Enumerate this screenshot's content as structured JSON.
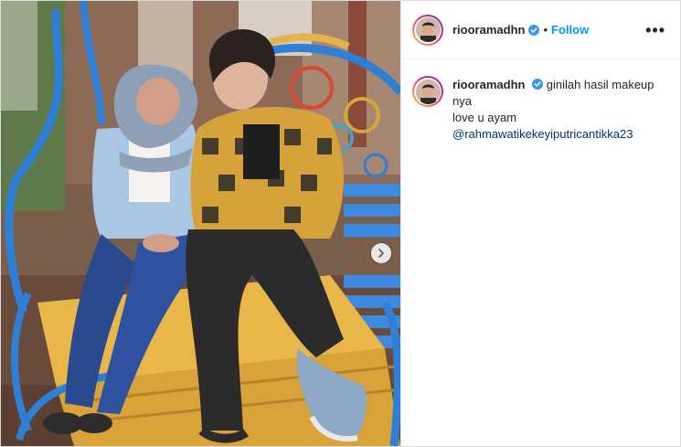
{
  "post": {
    "username": "riooramadhn",
    "follow_label": "Follow",
    "separator": "•",
    "more_label": "•••"
  },
  "caption": {
    "username": "riooramadhn",
    "line1": "ginilah hasil makeup",
    "line2": "nya",
    "line3": "love u ayam",
    "mention": "@rahmawatikekeyiputricantikka23"
  },
  "colors": {
    "accent": "#0095f6",
    "verified": "#3897f0",
    "mention": "#00376b",
    "text": "#262626"
  },
  "icons": {
    "verified": "verified-badge-icon",
    "next": "chevron-right-icon",
    "more": "more-options-icon"
  }
}
